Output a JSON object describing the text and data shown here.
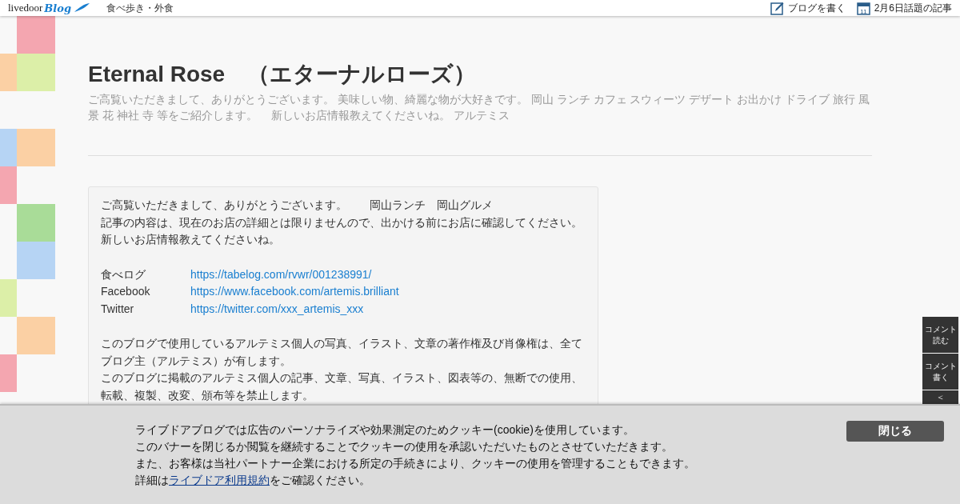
{
  "header": {
    "logo": {
      "wordmark": "livedoor",
      "blog": "Blog"
    },
    "category": "食べ歩き・外食",
    "links": [
      {
        "kind": "write",
        "label": "ブログを書く"
      },
      {
        "kind": "calendar",
        "day": "11",
        "label": "2月6日話題の記事"
      }
    ]
  },
  "blog": {
    "title": "Eternal Rose　（エターナルローズ）",
    "description": "ご高覧いただきまして、ありがとうございます。 美味しい物、綺麗な物が大好きです。 岡山 ランチ カフェ スウィーツ デザート お出かけ ドライブ 旅行 風景 花 神社 寺 等をご紹介します。　 新しいお店情報教えてくださいね。 アルテミス"
  },
  "profile": {
    "intro": [
      "ご高覧いただきまして、ありがとうございます。　　岡山ランチ　岡山グルメ",
      "記事の内容は、現在のお店の詳細とは限りませんので、出かける前にお店に確認してください。",
      "新しいお店情報教えてくださいね。"
    ],
    "links": [
      {
        "label": "食べログ",
        "url": "https://tabelog.com/rvwr/001238991/"
      },
      {
        "label": "Facebook",
        "url": "https://www.facebook.com/artemis.brilliant"
      },
      {
        "label": "Twitter",
        "url": "https://twitter.com/xxx_artemis_xxx"
      }
    ],
    "notice": [
      "このブログで使用しているアルテミス個人の写真、イラスト、文章の著作権及び肖像権は、全て",
      "ブログ主（アルテミス）が有します。",
      "このブログに掲載のアルテミス個人の記事、文章、写真、イラスト、図表等の、無断での使用、",
      "転載、複製、改変、頒布等を禁止します。"
    ]
  },
  "side_buttons": [
    {
      "kind": "text",
      "lines": [
        "コメント",
        "読む"
      ]
    },
    {
      "kind": "text",
      "lines": [
        "コメント",
        "書く"
      ]
    },
    {
      "kind": "arrow",
      "label": "＜"
    }
  ],
  "cookie_banner": {
    "lines": [
      "ライブドアブログでは広告のパーソナライズや効果測定のためクッキー(cookie)を使用しています。",
      "このバナーを閉じるか閲覧を継続することでクッキーの使用を承認いただいたものとさせていただきます。",
      "また、お客様は当社パートナー企業における所定の手続きにより、クッキーの使用を管理することもできます。"
    ],
    "last_before": "詳細は",
    "link": "ライブドア利用規約",
    "last_after": "をご確認ください。",
    "close": "閉じる"
  }
}
